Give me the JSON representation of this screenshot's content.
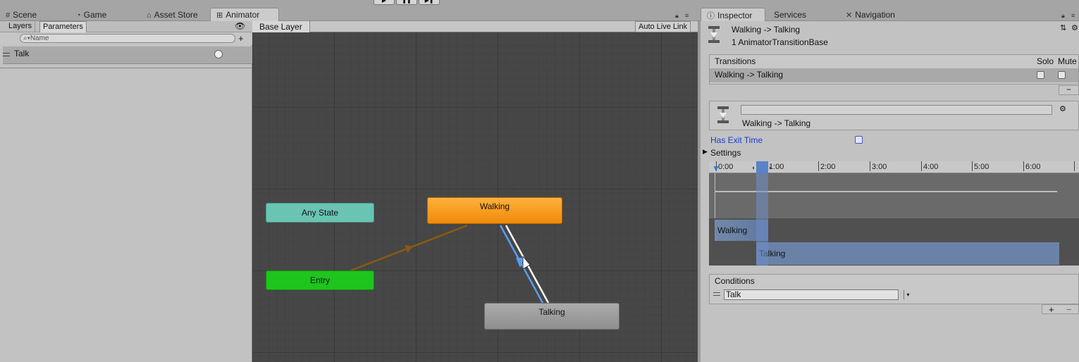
{
  "top_tabs": [
    {
      "label": "Scene",
      "icon": "grid-icon"
    },
    {
      "label": "Game",
      "icon": "pacman-icon"
    },
    {
      "label": "Asset Store",
      "icon": "store-icon"
    },
    {
      "label": "Animator",
      "icon": "animator-icon"
    }
  ],
  "right_tabs": [
    {
      "label": "Inspector",
      "icon": "info-icon"
    },
    {
      "label": "Services"
    },
    {
      "label": "Navigation",
      "icon": "navigation-icon"
    }
  ],
  "left_panel": {
    "tabs": [
      "Layers",
      "Parameters"
    ],
    "search_placeholder": "Name",
    "add_symbol": "+",
    "parameters": [
      {
        "name": "Talk",
        "type": "trigger"
      }
    ]
  },
  "graph": {
    "breadcrumb": "Base Layer",
    "auto_live_link": "Auto Live Link",
    "nodes": {
      "any_state": "Any State",
      "entry": "Entry",
      "walking": "Walking",
      "talking": "Talking"
    }
  },
  "inspector": {
    "title": "Walking -> Talking",
    "subtitle": "1 AnimatorTransitionBase",
    "transitions_header": "Transitions",
    "solo_label": "Solo",
    "mute_label": "Mute",
    "transitions": [
      {
        "label": "Walking -> Talking",
        "solo": false,
        "mute": false
      }
    ],
    "remove_symbol": "−",
    "transition_name_value": "",
    "transition_label": "Walking -> Talking",
    "has_exit_time_label": "Has Exit Time",
    "has_exit_time": false,
    "settings_label": "Settings",
    "timeline": {
      "ticks": [
        "0:00",
        "1:00",
        "2:00",
        "3:00",
        "4:00",
        "5:00",
        "6:00"
      ],
      "bars": [
        "Walking",
        "Talking"
      ]
    },
    "conditions_header": "Conditions",
    "condition_value": "Talk",
    "add_symbol": "+",
    "remove_cond_symbol": "−"
  },
  "colors": {
    "any_state": "#6ac4b3",
    "entry": "#1dc51d",
    "walking": "#f39a1e",
    "talking": "#9c9c9c",
    "transition_selected": "#5b9cf0",
    "has_exit_time_label": "#1a3ccf"
  }
}
